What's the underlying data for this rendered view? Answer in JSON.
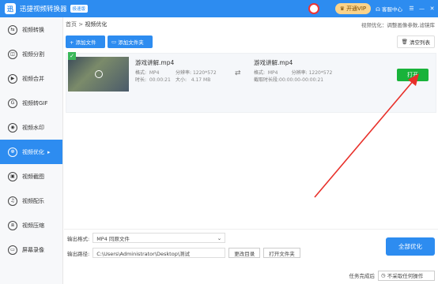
{
  "titlebar": {
    "logo": "迅",
    "app_title": "迅捷视频转换器",
    "edition": "极速版",
    "vip": "开通VIP",
    "service": "客服中心"
  },
  "sidebar": {
    "items": [
      {
        "label": "视频转换",
        "icon": "convert-icon"
      },
      {
        "label": "视频分割",
        "icon": "split-icon"
      },
      {
        "label": "视频合并",
        "icon": "merge-icon"
      },
      {
        "label": "视频转GIF",
        "icon": "gif-icon"
      },
      {
        "label": "视频水印",
        "icon": "watermark-icon"
      },
      {
        "label": "视频优化",
        "icon": "optimize-icon",
        "active": true
      },
      {
        "label": "视频截图",
        "icon": "screenshot-icon"
      },
      {
        "label": "视频配乐",
        "icon": "music-icon"
      },
      {
        "label": "视频压缩",
        "icon": "compress-icon"
      },
      {
        "label": "屏幕录像",
        "icon": "record-icon"
      }
    ]
  },
  "breadcrumb": {
    "home": "首页",
    "sep": ">",
    "current": "视频优化"
  },
  "hint": "视频优化：调整画像参数,滤镜库",
  "toolbar": {
    "add_file": "+ 添加文件",
    "add_folder": "添加文件夹",
    "clear": "清空列表"
  },
  "file": {
    "src_name": "游戏讲解.mp4",
    "src_format_label": "格式:",
    "src_format": "MP4",
    "src_res_label": "分辨率:",
    "src_res": "1220*572",
    "src_dur_label": "时长:",
    "src_dur": "00:00:21",
    "src_size_label": "大小:",
    "src_size": "4.17 MB",
    "out_name": "游戏讲解.mp4",
    "out_format_label": "格式:",
    "out_format": "MP4",
    "out_res_label": "分辨率:",
    "out_res": "1220*572",
    "out_range_label": "截取时长段:",
    "out_range": "00:00:00-00:00:21",
    "open": "打开"
  },
  "output": {
    "format_label": "输出格式:",
    "format_value": "MP4  同原文件",
    "path_label": "输出路径:",
    "path_value": "C:\\Users\\Administrator\\Desktop\\测试",
    "change_dir": "更改目录",
    "open_folder": "打开文件夹",
    "optimize_all": "全部优化"
  },
  "status": {
    "label": "任务完成后",
    "select": "不采取任何操作"
  },
  "colors": {
    "accent": "#2d8cf0",
    "open_green": "#19b33a",
    "annotation_red": "#e8302a"
  }
}
